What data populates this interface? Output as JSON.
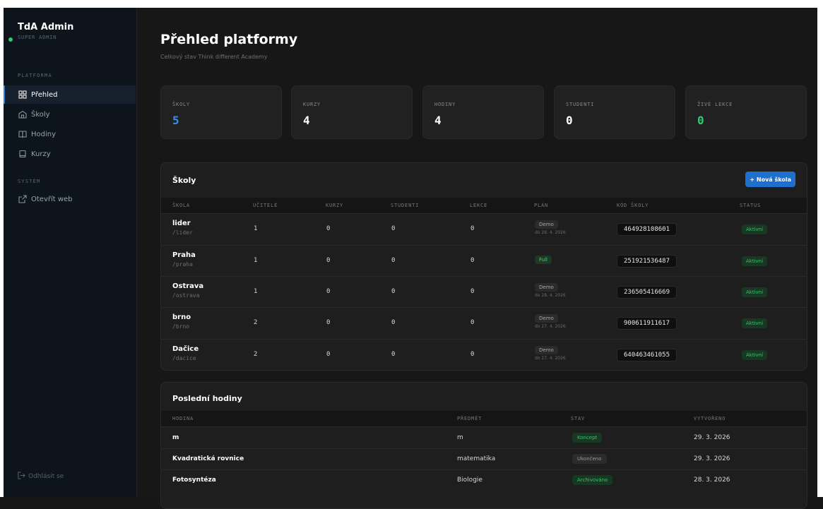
{
  "sidebar": {
    "brand_title": "TdA Admin",
    "brand_sub": "SUPER ADMIN",
    "section_platform": "PLATFORMA",
    "section_system": "SYSTÉM",
    "items": [
      {
        "label": "Přehled",
        "icon": "grid-icon"
      },
      {
        "label": "Školy",
        "icon": "school-icon"
      },
      {
        "label": "Hodiny",
        "icon": "book-icon"
      },
      {
        "label": "Kurzy",
        "icon": "course-icon"
      }
    ],
    "system_items": [
      {
        "label": "Otevřít web",
        "icon": "external-link-icon"
      }
    ],
    "logout": "Odhlásit se"
  },
  "header": {
    "title": "Přehled platformy",
    "subtitle": "Celkový stav Think different Academy"
  },
  "stats": [
    {
      "label": "ŠKOLY",
      "value": "5",
      "color": "#3a8ee6"
    },
    {
      "label": "KURZY",
      "value": "4",
      "color": "#ffffff"
    },
    {
      "label": "HODINY",
      "value": "4",
      "color": "#ffffff"
    },
    {
      "label": "STUDENTI",
      "value": "0",
      "color": "#ffffff"
    },
    {
      "label": "ŽIVÉ LEKCE",
      "value": "0",
      "color": "#2ecc71"
    }
  ],
  "schools": {
    "title": "Školy",
    "new_button": "+ Nová škola",
    "columns": [
      "ŠKOLA",
      "UČITELÉ",
      "KURZY",
      "STUDENTI",
      "LEKCE",
      "PLÁN",
      "KÓD ŠKOLY",
      "STATUS"
    ],
    "rows": [
      {
        "name": "lider",
        "slug": "/lider",
        "teachers": "1",
        "courses": "0",
        "students": "0",
        "lessons": "0",
        "plan": "Demo",
        "plan_date": "do 28. 4. 2026",
        "code": "464928108601",
        "status": "Aktivní"
      },
      {
        "name": "Praha",
        "slug": "/praha",
        "teachers": "1",
        "courses": "0",
        "students": "0",
        "lessons": "0",
        "plan": "Full",
        "plan_date": "",
        "code": "251921536487",
        "status": "Aktivní"
      },
      {
        "name": "Ostrava",
        "slug": "/ostrava",
        "teachers": "1",
        "courses": "0",
        "students": "0",
        "lessons": "0",
        "plan": "Demo",
        "plan_date": "do 28. 4. 2026",
        "code": "236505416669",
        "status": "Aktivní"
      },
      {
        "name": "brno",
        "slug": "/brno",
        "teachers": "2",
        "courses": "0",
        "students": "0",
        "lessons": "0",
        "plan": "Demo",
        "plan_date": "do 27. 4. 2026",
        "code": "900611911617",
        "status": "Aktivní"
      },
      {
        "name": "Dačice",
        "slug": "/dacice",
        "teachers": "2",
        "courses": "0",
        "students": "0",
        "lessons": "0",
        "plan": "Demo",
        "plan_date": "do 27. 4. 2026",
        "code": "640463461055",
        "status": "Aktivní"
      }
    ]
  },
  "lessons": {
    "title": "Poslední hodiny",
    "columns": [
      "HODINA",
      "PŘEDMĚT",
      "STAV",
      "VYTVOŘENO"
    ],
    "rows": [
      {
        "name": "m",
        "subject": "m",
        "state": "Koncept",
        "created": "29. 3. 2026"
      },
      {
        "name": "Kvadratická rovnice",
        "subject": "matematika",
        "state": "Ukončeno",
        "created": "29. 3. 2026"
      },
      {
        "name": "Fotosyntéza",
        "subject": "Biologie",
        "state": "Archivováno",
        "created": "28. 3. 2026"
      }
    ]
  }
}
